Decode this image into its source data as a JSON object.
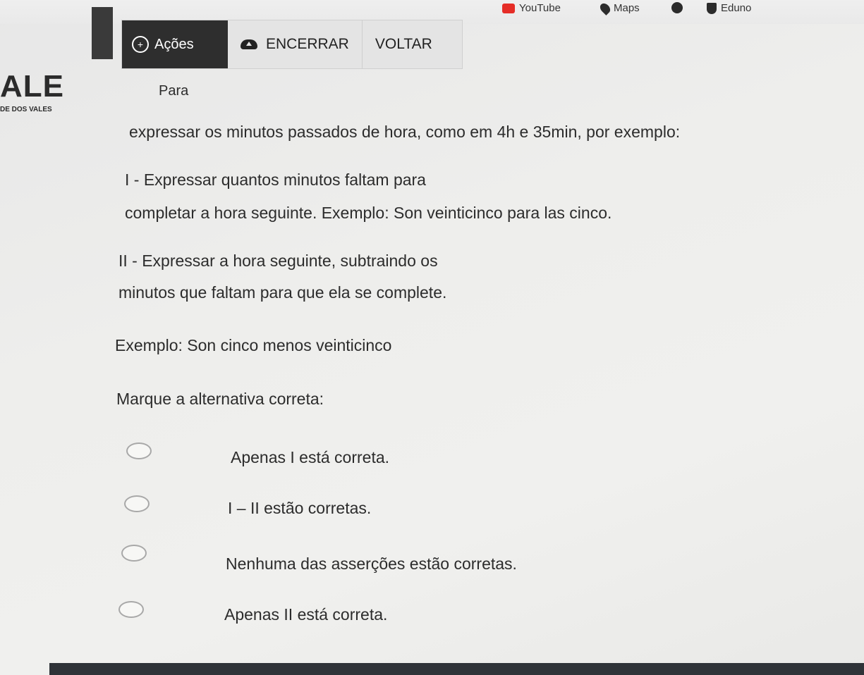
{
  "bookmarks": {
    "youtube": "YouTube",
    "maps": "Maps",
    "eduno": "Eduno"
  },
  "toolbar": {
    "acoes": "Ações",
    "encerrar": "ENCERRAR",
    "voltar": "VOLTAR"
  },
  "logo": {
    "text": "ALE",
    "sub": "DE DOS VALES"
  },
  "question": {
    "line1": "Para",
    "line2": "expressar os minutos passados de hora, como em 4h e 35min, por exemplo:",
    "item1_a": "I - Expressar quantos minutos faltam para",
    "item1_b": "completar a hora seguinte. Exemplo: Son veinticinco para las cinco.",
    "item2_a": "II - Expressar a hora seguinte, subtraindo os",
    "item2_b": "minutos que faltam para que ela se complete.",
    "example": "Exemplo: Son cinco menos veinticinco",
    "prompt": "Marque a alternativa correta:"
  },
  "options": [
    {
      "label": "Apenas I está correta."
    },
    {
      "label": "I – II estão corretas."
    },
    {
      "label": "Nenhuma das asserções estão corretas."
    },
    {
      "label": "Apenas II está correta."
    }
  ]
}
